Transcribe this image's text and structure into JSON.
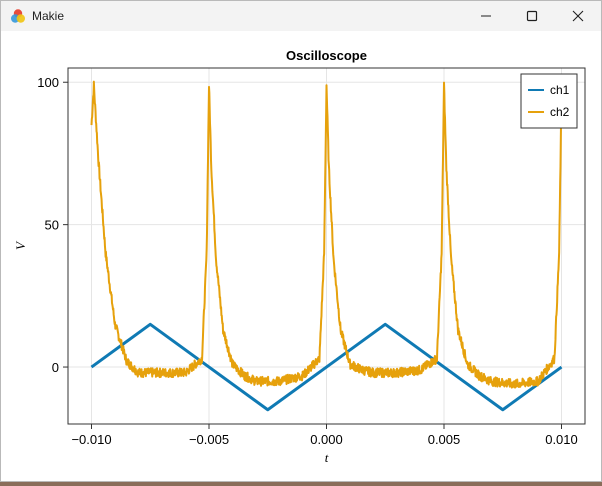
{
  "window": {
    "title": "Makie",
    "app_icon": "makie-logo-icon",
    "controls": [
      "minimize-icon",
      "maximize-icon",
      "close-icon"
    ]
  },
  "colors": {
    "ch1": "#0f7ab4",
    "ch2": "#e6a10c",
    "grid": "#e5e5e5",
    "axis": "#333333"
  },
  "chart_data": {
    "type": "line",
    "title": "Oscilloscope",
    "xlabel": "t",
    "ylabel": "V",
    "xlim": [
      -0.011,
      0.011
    ],
    "ylim": [
      -20,
      105
    ],
    "xticks": [
      -0.01,
      -0.005,
      0.0,
      0.005,
      0.01
    ],
    "xtick_labels": [
      "−0.010",
      "−0.005",
      "0.000",
      "0.005",
      "0.010"
    ],
    "yticks": [
      0,
      50,
      100
    ],
    "ytick_labels": [
      "0",
      "50",
      "100"
    ],
    "grid": true,
    "legend_position": "top-right",
    "series": [
      {
        "name": "ch1",
        "x": [
          -0.01,
          -0.0075,
          -0.0025,
          0.0025,
          0.0075,
          0.01
        ],
        "y": [
          0,
          15,
          -15,
          15,
          -15,
          0
        ]
      },
      {
        "name": "ch2",
        "x": [
          -0.01,
          -0.0099,
          -0.0097,
          -0.0094,
          -0.009,
          -0.0085,
          -0.008,
          -0.007,
          -0.006,
          -0.0053,
          -0.0051,
          -0.005,
          -0.0049,
          -0.0047,
          -0.0044,
          -0.004,
          -0.0035,
          -0.003,
          -0.002,
          -0.001,
          -0.0003,
          -0.0001,
          0.0,
          0.0001,
          0.0003,
          0.0006,
          0.001,
          0.0015,
          0.002,
          0.003,
          0.004,
          0.0047,
          0.0049,
          0.005,
          0.0051,
          0.0053,
          0.0056,
          0.006,
          0.0065,
          0.007,
          0.008,
          0.009,
          0.0097,
          0.0099,
          0.01
        ],
        "y": [
          85,
          99,
          72,
          40,
          15,
          2,
          -2,
          -2,
          -2,
          3,
          40,
          99,
          70,
          38,
          13,
          1,
          -3,
          -5,
          -5,
          -3,
          3,
          40,
          99,
          70,
          38,
          13,
          1,
          -1,
          -2,
          -2,
          -1,
          3,
          40,
          99,
          70,
          38,
          13,
          1,
          -3,
          -5,
          -6,
          -5,
          3,
          40,
          95
        ]
      }
    ]
  }
}
